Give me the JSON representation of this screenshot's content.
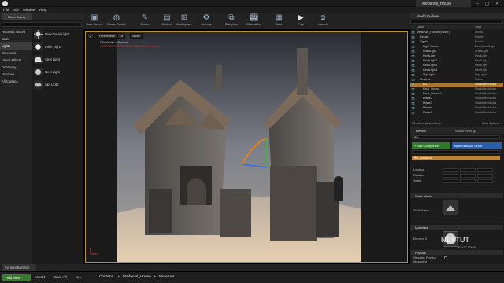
{
  "window": {
    "tab_title": "Medieval_House"
  },
  "menu": [
    "File",
    "Edit",
    "Window",
    "Help"
  ],
  "mode_tab": "Place Actors",
  "place": {
    "categories": [
      "Recently Placed",
      "Basic",
      "Lights",
      "Cinematic",
      "Visual Effects",
      "Geometry",
      "Volumes",
      "All Classes"
    ],
    "selected_category": "Lights",
    "items": [
      "Directional Light",
      "Point Light",
      "Spot Light",
      "Rect Light",
      "Sky Light"
    ]
  },
  "toolbar": [
    "Save Current",
    "Source Control",
    "Modes",
    "Content",
    "Marketplace",
    "Settings",
    "Blueprints",
    "Cinematics",
    "Build",
    "Play",
    "Launch"
  ],
  "viewport": {
    "buttons": [
      "Perspective",
      "Lit",
      "Show"
    ],
    "overlay": "Pilot Active - Camera",
    "overlay2": "LIGHTING NEEDS TO BE REBUILT (1 unbuilt)"
  },
  "outliner": {
    "title": "World Outliner",
    "col_label": "Label",
    "col_type": "Type",
    "rows": [
      {
        "label": "Medieval_House (Editor)",
        "type": "World"
      },
      {
        "label": "Decals",
        "type": "Folder"
      },
      {
        "label": "Lights",
        "type": "Folder"
      },
      {
        "label": "Light Source",
        "type": "DirectionalLight"
      },
      {
        "label": "PointLight",
        "type": "PointLight"
      },
      {
        "label": "RectLight",
        "type": "RectLight"
      },
      {
        "label": "RectLight2",
        "type": "RectLight"
      },
      {
        "label": "RectLight3",
        "type": "RectLight"
      },
      {
        "label": "RectLight4",
        "type": "RectLight"
      },
      {
        "label": "SkyLight",
        "type": "SkyLight"
      },
      {
        "label": "Meshes",
        "type": "Folder"
      },
      {
        "label": "BG",
        "type": "StaticMeshActor"
      },
      {
        "label": "Final_House",
        "type": "StaticMeshActor"
      },
      {
        "label": "Final_House2",
        "type": "StaticMeshActor"
      },
      {
        "label": "Plane2",
        "type": "StaticMeshActor"
      },
      {
        "label": "Plane3",
        "type": "StaticMeshActor"
      },
      {
        "label": "Plane4",
        "type": "StaticMeshActor"
      },
      {
        "label": "Plane5",
        "type": "StaticMeshActor"
      }
    ],
    "selected_index": 11,
    "footer": "18 actors (1 selected)",
    "view_options": "View Options"
  },
  "details": {
    "tab1": "Details",
    "tab2": "World Settings",
    "name_value": "BG",
    "add_component": "+ Add Component",
    "blueprint": "Blueprint/Add Script",
    "search_placeholder": "Search Components",
    "component": "BG (Instance)",
    "transform_labels": [
      "Location",
      "Rotation",
      "Scale"
    ],
    "section_static_mesh": "Static Mesh",
    "static_mesh_label": "Static Mesh",
    "section_materials": "Materials",
    "element_label": "Element 0",
    "section_physics": "Physics",
    "simulate_physics": "Simulate Physics",
    "mass": "MassInKg"
  },
  "content_browser": {
    "tab": "Content Browser",
    "add_new": "Add New",
    "import": "Import",
    "save_all": "Save All",
    "crumbs": [
      "Content",
      "Medieval_House",
      "Materials"
    ]
  },
  "watermark": {
    "main": "NEXTUT",
    "sub": "EDUCATION"
  },
  "colors": {
    "selection": "#a8762a",
    "add_new": "#3a7a2e",
    "add_component": "#2f7a2a",
    "blueprint": "#2a5ea8"
  }
}
